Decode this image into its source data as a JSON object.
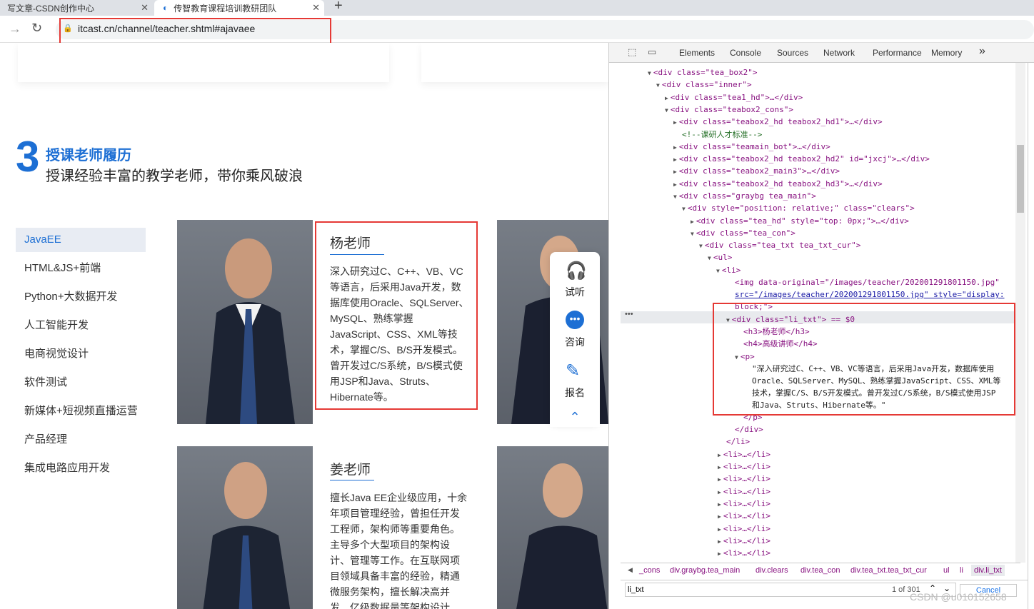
{
  "browser": {
    "tabs": [
      {
        "title": "写文章-CSDN创作中心"
      },
      {
        "title": "传智教育课程培训教研团队"
      }
    ],
    "new_tab_icon": "+",
    "url": "itcast.cn/channel/teacher.shtml#ajavaee"
  },
  "section": {
    "number": "3",
    "title": "授课老师履历",
    "subtitle": "授课经验丰富的教学老师，带你乘风破浪"
  },
  "menu": [
    "JavaEE",
    "HTML&JS+前端",
    "Python+大数据开发",
    "人工智能开发",
    "电商视觉设计",
    "软件测试",
    "新媒体+短视频直播运营",
    "产品经理",
    "集成电路应用开发"
  ],
  "teachers": [
    {
      "name": "杨老师",
      "desc": "深入研究过C、C++、VB、VC等语言，后采用Java开发，数据库使用Oracle、SQLServer、MySQL、熟练掌握JavaScript、CSS、XML等技术，掌握C/S、B/S开发模式。曾开发过C/S系统，B/S模式使用JSP和Java、Struts、Hibernate等。"
    },
    {
      "name": "姜老师",
      "desc": "擅长Java EE企业级应用，十余年项目管理经验，曾担任开发工程师，架构师等重要角色。主导多个大型项目的架构设计、管理等工作。在互联网项目领域具备丰富的经验，精通微服务架构，擅长解决高并发、亿级数据量等架构设计"
    }
  ],
  "float": {
    "listen": "试听",
    "consult": "咨询",
    "signup": "报名"
  },
  "devtools": {
    "tabs": [
      "Elements",
      "Console",
      "Sources",
      "Network",
      "Performance",
      "Memory"
    ],
    "more": "»",
    "tree": [
      "<div class=\"tea_box2\">",
      "<div class=\"inner\">",
      "<div class=\"tea1_hd\">…</div>",
      "<div class=\"teabox2_cons\">",
      "<div class=\"teabox2_hd teabox2_hd1\">…</div>",
      "<!--课研人才标准-->",
      "<div class=\"teamain_bot\">…</div>",
      "<div class=\"teabox2_hd teabox2_hd2\" id=\"jxcj\">…</div>",
      "<div class=\"teabox2_main3\">…</div>",
      "<div class=\"teabox2_hd teabox2_hd3\">…</div>",
      "<div class=\"graybg tea_main\">",
      "<div style=\"position: relative;\" class=\"clears\">",
      "<div class=\"tea_hd\" style=\"top: 0px;\">…</div>",
      "<div class=\"tea_con\">",
      "<div class=\"tea_txt tea_txt_cur\">",
      "<ul>",
      "<li>",
      "<img data-original=\"/images/teacher/202001291801150.jpg\"",
      "src=\"/images/teacher/202001291801150.jpg\" style=\"display:",
      "block;\">",
      "<div class=\"li_txt\"> == $0",
      "<h3>杨老师</h3>",
      "<h4>高级讲师</h4>",
      "<p>",
      "\"深入研究过C、C++、VB、VC等语言，后采用Java开发，数据库使用",
      "Oracle、SQLServer、MySQL、熟练掌握JavaScript、CSS、XML等",
      "技术，掌握C/S、B/S开发模式。曾开发过C/S系统，B/S模式使用JSP",
      "和Java、Struts、Hibernate等。\"",
      "</p>",
      "</div>",
      "</li>",
      "<li>…</li>"
    ],
    "breadcrumbs": [
      "_cons",
      "div.graybg.tea_main",
      "div.clears",
      "div.tea_con",
      "div.tea_txt.tea_txt_cur",
      "ul",
      "li",
      "div.li_txt"
    ],
    "find": {
      "query": "li_txt",
      "count": "1 of 301",
      "cancel": "Cancel"
    }
  },
  "watermark": "CSDN @u010152658"
}
